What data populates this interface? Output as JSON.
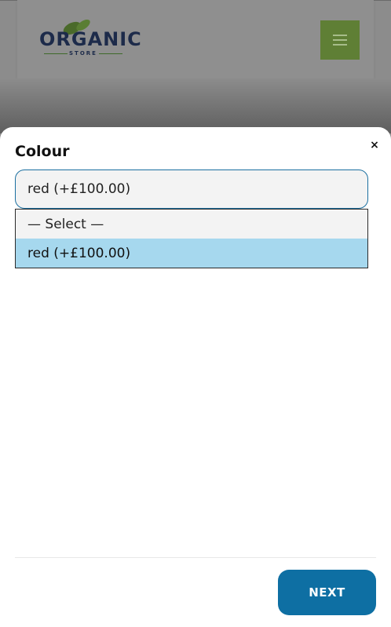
{
  "header": {
    "logo_text": "ORGANIC",
    "logo_subtext": "STORE",
    "menu_icon": "hamburger-menu-icon"
  },
  "modal": {
    "close_label": "×",
    "field_label": "Colour",
    "select_value": "red (+£100.00)",
    "options": [
      {
        "label": "— Select —",
        "selected": false
      },
      {
        "label": "red (+£100.00)",
        "selected": true
      }
    ],
    "next_label": "NEXT"
  },
  "colors": {
    "accent": "#0e6fa3",
    "menu_button": "#6cb33f",
    "option_highlight": "#a6d8ee"
  }
}
